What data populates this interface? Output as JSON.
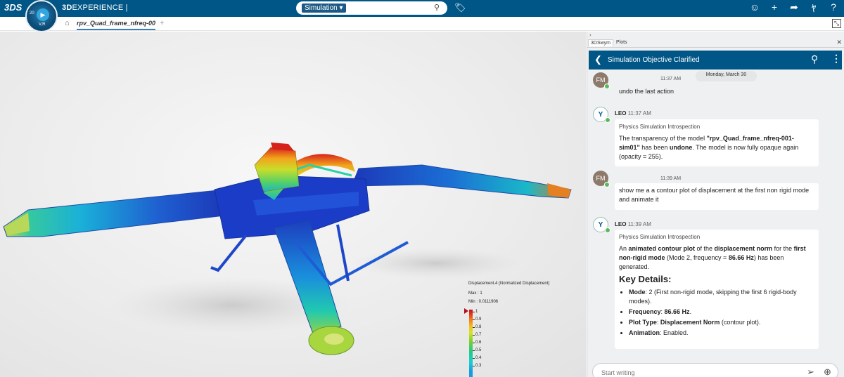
{
  "topbar": {
    "logo": "3DS",
    "brand_bold": "3D",
    "brand_rest": "EXPERIENCE |",
    "compass_label": "20",
    "compass_vr": "V,R",
    "search_scope": "Simulation",
    "search_value": "",
    "icons": [
      "tag-icon",
      "user-icon",
      "add-icon",
      "share-icon",
      "apps-icon",
      "help-icon"
    ]
  },
  "tabs": {
    "active": "rpv_Quad_frame_nfreq-00",
    "add": "+"
  },
  "legend": {
    "title": "Displacement.4 (Normalized Displacement)",
    "max": "Max : 1",
    "min": "Min : 0.0111906",
    "ticks": [
      "1",
      "0.9",
      "0.8",
      "0.7",
      "0.6",
      "0.5",
      "0.4",
      "0.3"
    ]
  },
  "panel": {
    "tabs": [
      "3DSwym",
      "Plots"
    ],
    "header_title": "Simulation Objective Clarified",
    "date": "Monday, March 30",
    "messages": {
      "m1": {
        "initials": "FM",
        "time": "11:37 AM",
        "text": "undo the last action"
      },
      "m2": {
        "sender": "LEO",
        "time": "11:37 AM",
        "subtitle": "Physics Simulation Introspection",
        "p1": "The transparency of the model ",
        "p1_bold": "\"rpv_Quad_frame_nfreq-001-sim01\"",
        "p1b": " has been ",
        "p1_bold2": "undone",
        "p1c": ". The model is now fully opaque again (opacity = 255)."
      },
      "m3": {
        "initials": "FM",
        "time": "11:39 AM",
        "text": "show me a a contour plot of displacement at the first non rigid mode and animate it"
      },
      "m4": {
        "sender": "LEO",
        "time": "11:39 AM",
        "subtitle": "Physics Simulation Introspection",
        "p_a": "An ",
        "p_b": "animated contour plot",
        "p_c": " of the ",
        "p_d": "displacement norm",
        "p_e": " for the ",
        "p_f": "first non-rigid mode",
        "p_g": " (Mode 2, frequency = ",
        "p_h": "86.66 Hz",
        "p_i": ") has been generated.",
        "heading": "Key Details:",
        "items": [
          {
            "k": "Mode",
            "v": ": 2 (First non-rigid mode, skipping the first 6 rigid-body modes)."
          },
          {
            "k": "Frequency",
            "v": ": ",
            "vb": "86.66 Hz",
            "tail": "."
          },
          {
            "k": "Plot Type",
            "v": ": ",
            "vb": "Displacement Norm",
            "tail": " (contour plot)."
          },
          {
            "k": "Animation",
            "v": ": Enabled."
          }
        ]
      }
    },
    "composer_placeholder": "Start writing"
  },
  "colors": {
    "topbar": "#005686",
    "accent": "#3b7fb8"
  }
}
